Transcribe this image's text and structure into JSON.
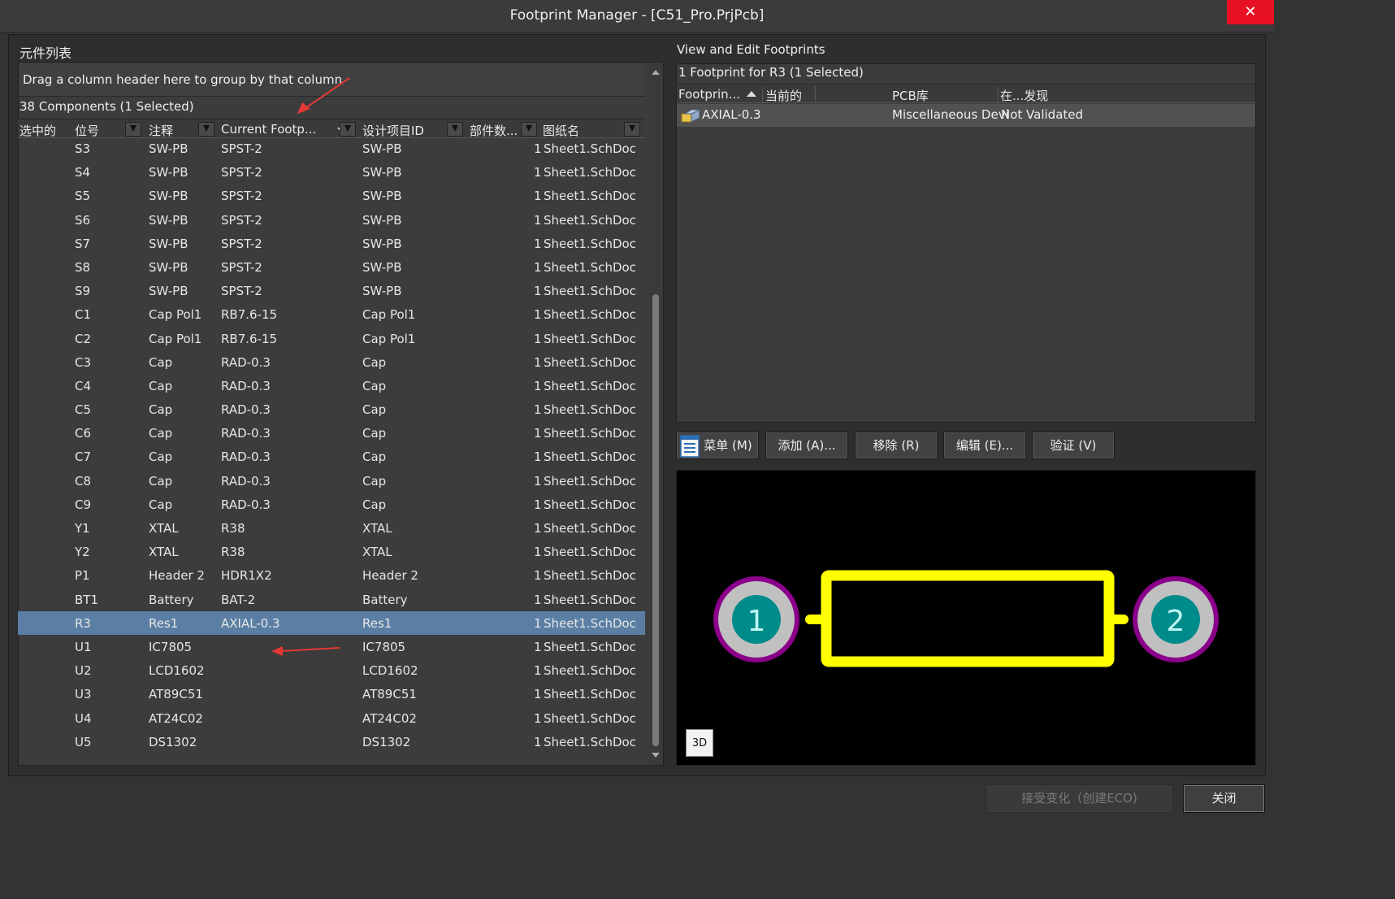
{
  "window": {
    "title": "Footprint Manager - [C51_Pro.PrjPcb]",
    "close_glyph": "✕"
  },
  "left": {
    "section_title": "元件列表",
    "group_hint": "Drag a column header here to group by that column",
    "count": "38 Components (1 Selected)",
    "columns": {
      "selected": "选中的",
      "designator": "位号",
      "comment": "注释",
      "current_footprint": "Current Footp...",
      "design_item_id": "设计项目ID",
      "part_count": "部件数...",
      "sheet": "图纸名"
    },
    "rows": [
      {
        "d": "S3",
        "c": "SW-PB",
        "f": "SPST-2",
        "id": "SW-PB",
        "n": "1",
        "s": "Sheet1.SchDoc"
      },
      {
        "d": "S4",
        "c": "SW-PB",
        "f": "SPST-2",
        "id": "SW-PB",
        "n": "1",
        "s": "Sheet1.SchDoc"
      },
      {
        "d": "S5",
        "c": "SW-PB",
        "f": "SPST-2",
        "id": "SW-PB",
        "n": "1",
        "s": "Sheet1.SchDoc"
      },
      {
        "d": "S6",
        "c": "SW-PB",
        "f": "SPST-2",
        "id": "SW-PB",
        "n": "1",
        "s": "Sheet1.SchDoc"
      },
      {
        "d": "S7",
        "c": "SW-PB",
        "f": "SPST-2",
        "id": "SW-PB",
        "n": "1",
        "s": "Sheet1.SchDoc"
      },
      {
        "d": "S8",
        "c": "SW-PB",
        "f": "SPST-2",
        "id": "SW-PB",
        "n": "1",
        "s": "Sheet1.SchDoc"
      },
      {
        "d": "S9",
        "c": "SW-PB",
        "f": "SPST-2",
        "id": "SW-PB",
        "n": "1",
        "s": "Sheet1.SchDoc"
      },
      {
        "d": "C1",
        "c": "Cap Pol1",
        "f": "RB7.6-15",
        "id": "Cap Pol1",
        "n": "1",
        "s": "Sheet1.SchDoc"
      },
      {
        "d": "C2",
        "c": "Cap Pol1",
        "f": "RB7.6-15",
        "id": "Cap Pol1",
        "n": "1",
        "s": "Sheet1.SchDoc"
      },
      {
        "d": "C3",
        "c": "Cap",
        "f": "RAD-0.3",
        "id": "Cap",
        "n": "1",
        "s": "Sheet1.SchDoc"
      },
      {
        "d": "C4",
        "c": "Cap",
        "f": "RAD-0.3",
        "id": "Cap",
        "n": "1",
        "s": "Sheet1.SchDoc"
      },
      {
        "d": "C5",
        "c": "Cap",
        "f": "RAD-0.3",
        "id": "Cap",
        "n": "1",
        "s": "Sheet1.SchDoc"
      },
      {
        "d": "C6",
        "c": "Cap",
        "f": "RAD-0.3",
        "id": "Cap",
        "n": "1",
        "s": "Sheet1.SchDoc"
      },
      {
        "d": "C7",
        "c": "Cap",
        "f": "RAD-0.3",
        "id": "Cap",
        "n": "1",
        "s": "Sheet1.SchDoc"
      },
      {
        "d": "C8",
        "c": "Cap",
        "f": "RAD-0.3",
        "id": "Cap",
        "n": "1",
        "s": "Sheet1.SchDoc"
      },
      {
        "d": "C9",
        "c": "Cap",
        "f": "RAD-0.3",
        "id": "Cap",
        "n": "1",
        "s": "Sheet1.SchDoc"
      },
      {
        "d": "Y1",
        "c": "XTAL",
        "f": "R38",
        "id": "XTAL",
        "n": "1",
        "s": "Sheet1.SchDoc"
      },
      {
        "d": "Y2",
        "c": "XTAL",
        "f": "R38",
        "id": "XTAL",
        "n": "1",
        "s": "Sheet1.SchDoc"
      },
      {
        "d": "P1",
        "c": "Header 2",
        "f": "HDR1X2",
        "id": "Header 2",
        "n": "1",
        "s": "Sheet1.SchDoc"
      },
      {
        "d": "BT1",
        "c": "Battery",
        "f": "BAT-2",
        "id": "Battery",
        "n": "1",
        "s": "Sheet1.SchDoc"
      },
      {
        "d": "R3",
        "c": "Res1",
        "f": "AXIAL-0.3",
        "id": "Res1",
        "n": "1",
        "s": "Sheet1.SchDoc",
        "selected": true
      },
      {
        "d": "U1",
        "c": "IC7805",
        "f": "",
        "id": "IC7805",
        "n": "1",
        "s": "Sheet1.SchDoc"
      },
      {
        "d": "U2",
        "c": "LCD1602",
        "f": "",
        "id": "LCD1602",
        "n": "1",
        "s": "Sheet1.SchDoc"
      },
      {
        "d": "U3",
        "c": "AT89C51",
        "f": "",
        "id": "AT89C51",
        "n": "1",
        "s": "Sheet1.SchDoc"
      },
      {
        "d": "U4",
        "c": "AT24C02",
        "f": "",
        "id": "AT24C02",
        "n": "1",
        "s": "Sheet1.SchDoc"
      },
      {
        "d": "U5",
        "c": "DS1302",
        "f": "",
        "id": "DS1302",
        "n": "1",
        "s": "Sheet1.SchDoc"
      }
    ]
  },
  "right": {
    "section_title": "View and Edit Footprints",
    "count": "1 Footprint for R3 (1 Selected)",
    "columns": {
      "footprint": "Footprin...",
      "current": "当前的",
      "pcb_lib": "PCB库",
      "found_in": "在...发现"
    },
    "footprint_row": {
      "name": "AXIAL-0.3",
      "library": "Miscellaneous Devi",
      "found": "Not Validated"
    },
    "buttons": {
      "menu": "菜单 (M)",
      "add": "添加 (A)...",
      "remove": "移除 (R)",
      "edit": "编辑 (E)...",
      "validate": "验证 (V)"
    },
    "preview": {
      "pad1": "1",
      "pad2": "2",
      "btn_3d": "3D"
    }
  },
  "footer": {
    "accept": "接受变化（创建ECO)",
    "close": "关闭"
  },
  "colors": {
    "selection": "#5b7fa4",
    "silkscreen": "#ffff00",
    "pad_ring": "#8b008b",
    "pad_copper": "#c0c0c0",
    "pad_hole": "#008b8b",
    "annotation_arrow": "#e53935"
  }
}
